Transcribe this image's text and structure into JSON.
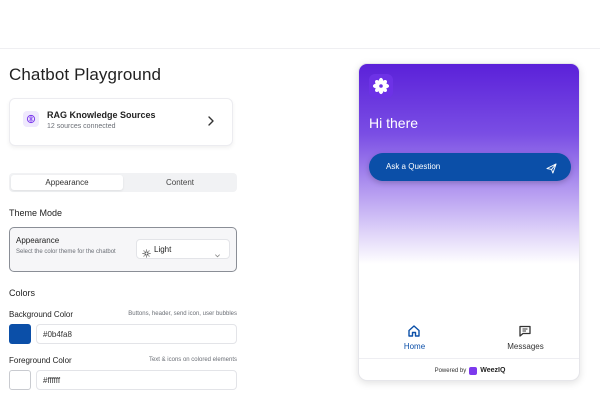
{
  "page": {
    "title": "Chatbot Playground"
  },
  "rag": {
    "title": "RAG Knowledge Sources",
    "subtitle": "12 sources connected",
    "icon": "brain-icon"
  },
  "tabs": [
    {
      "label": "Appearance",
      "active": true
    },
    {
      "label": "Content",
      "active": false
    }
  ],
  "theme": {
    "section": "Theme Mode",
    "label": "Appearance",
    "description": "Select the color theme for the chatbot",
    "selected": "Light",
    "icon": "sun-icon"
  },
  "colors": {
    "section": "Colors",
    "background": {
      "label": "Background Color",
      "hint": "Buttons, header, send icon, user bubbles",
      "value": "#0b4fa8"
    },
    "foreground": {
      "label": "Foreground Color",
      "hint": "Text & icons on colored elements",
      "value": "#ffffff"
    }
  },
  "preview": {
    "greeting": "Hi there",
    "ask_label": "Ask a Question",
    "nav": [
      {
        "label": "Home",
        "icon": "home-icon",
        "active": true
      },
      {
        "label": "Messages",
        "icon": "chat-icon",
        "active": false
      }
    ],
    "powered_by": "Powered by",
    "brand": "WeezIQ",
    "accent": "#5b21d9",
    "button_color": "#0b4fa8"
  }
}
